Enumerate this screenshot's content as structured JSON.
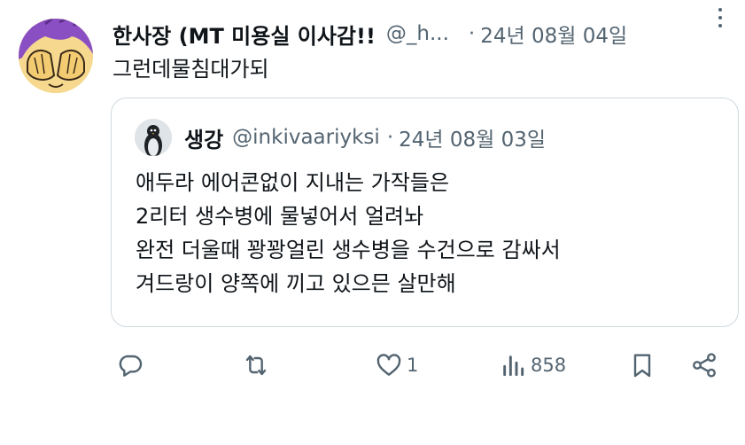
{
  "tweet": {
    "author": {
      "display_name": "한사장 (MT 미용실 이사감!!",
      "handle": "@_h...",
      "avatar_icon": "avatar-cartoon-face-covering-icon"
    },
    "separator": "·",
    "date": "24년 08월 04일",
    "text": "그런데물침대가되",
    "more_icon": "more-options-icon"
  },
  "quote": {
    "author": {
      "display_name": "생강",
      "handle": "@inkivaariyksi",
      "avatar_icon": "avatar-penguin-icon"
    },
    "separator": "·",
    "date": "24년 08월 03일",
    "lines": [
      "애두라 에어콘없이 지내는 가작들은",
      "2리터 생수병에 물넣어서 얼려놔",
      "완전 더울때 꽝꽝얼린 생수병을 수건으로 감싸서",
      "겨드랑이 양쪽에 끼고 있으믄 살만해"
    ]
  },
  "actions": {
    "reply": {
      "icon": "reply-icon",
      "count": ""
    },
    "repost": {
      "icon": "repost-icon",
      "count": ""
    },
    "like": {
      "icon": "heart-icon",
      "count": "1"
    },
    "views": {
      "icon": "views-icon",
      "count": "858"
    },
    "bookmark": {
      "icon": "bookmark-icon",
      "count": ""
    },
    "share": {
      "icon": "share-icon",
      "count": ""
    }
  },
  "colors": {
    "text_primary": "#0f1419",
    "text_secondary": "#536471",
    "border": "#cfd9de",
    "avatar_hair": "#8b4fc4",
    "avatar_skin": "#f6d98e"
  }
}
